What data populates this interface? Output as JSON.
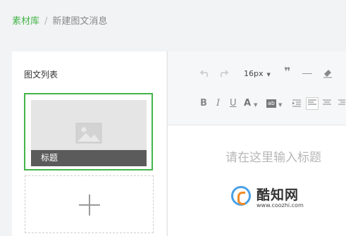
{
  "breadcrumb": {
    "library": "素材库",
    "separator": "/",
    "current": "新建图文消息"
  },
  "left_panel": {
    "title": "图文列表",
    "article": {
      "cover_icon": "image-placeholder-icon",
      "title": "标题"
    },
    "add_icon": "plus-icon"
  },
  "toolbar": {
    "undo_icon": "undo-icon",
    "redo_icon": "redo-icon",
    "font_size": "16px",
    "quote_icon": "quote-icon",
    "hr_icon": "horizontal-rule-icon",
    "clear_format_icon": "eraser-icon",
    "bold": "B",
    "italic": "I",
    "underline": "U",
    "font_color": "A",
    "bg_color": "ab",
    "accent": "#44b549"
  },
  "editor": {
    "title_placeholder": "请在这里输入标题"
  },
  "watermark": {
    "name": "酷知网",
    "url": "www.coozhi.com"
  }
}
